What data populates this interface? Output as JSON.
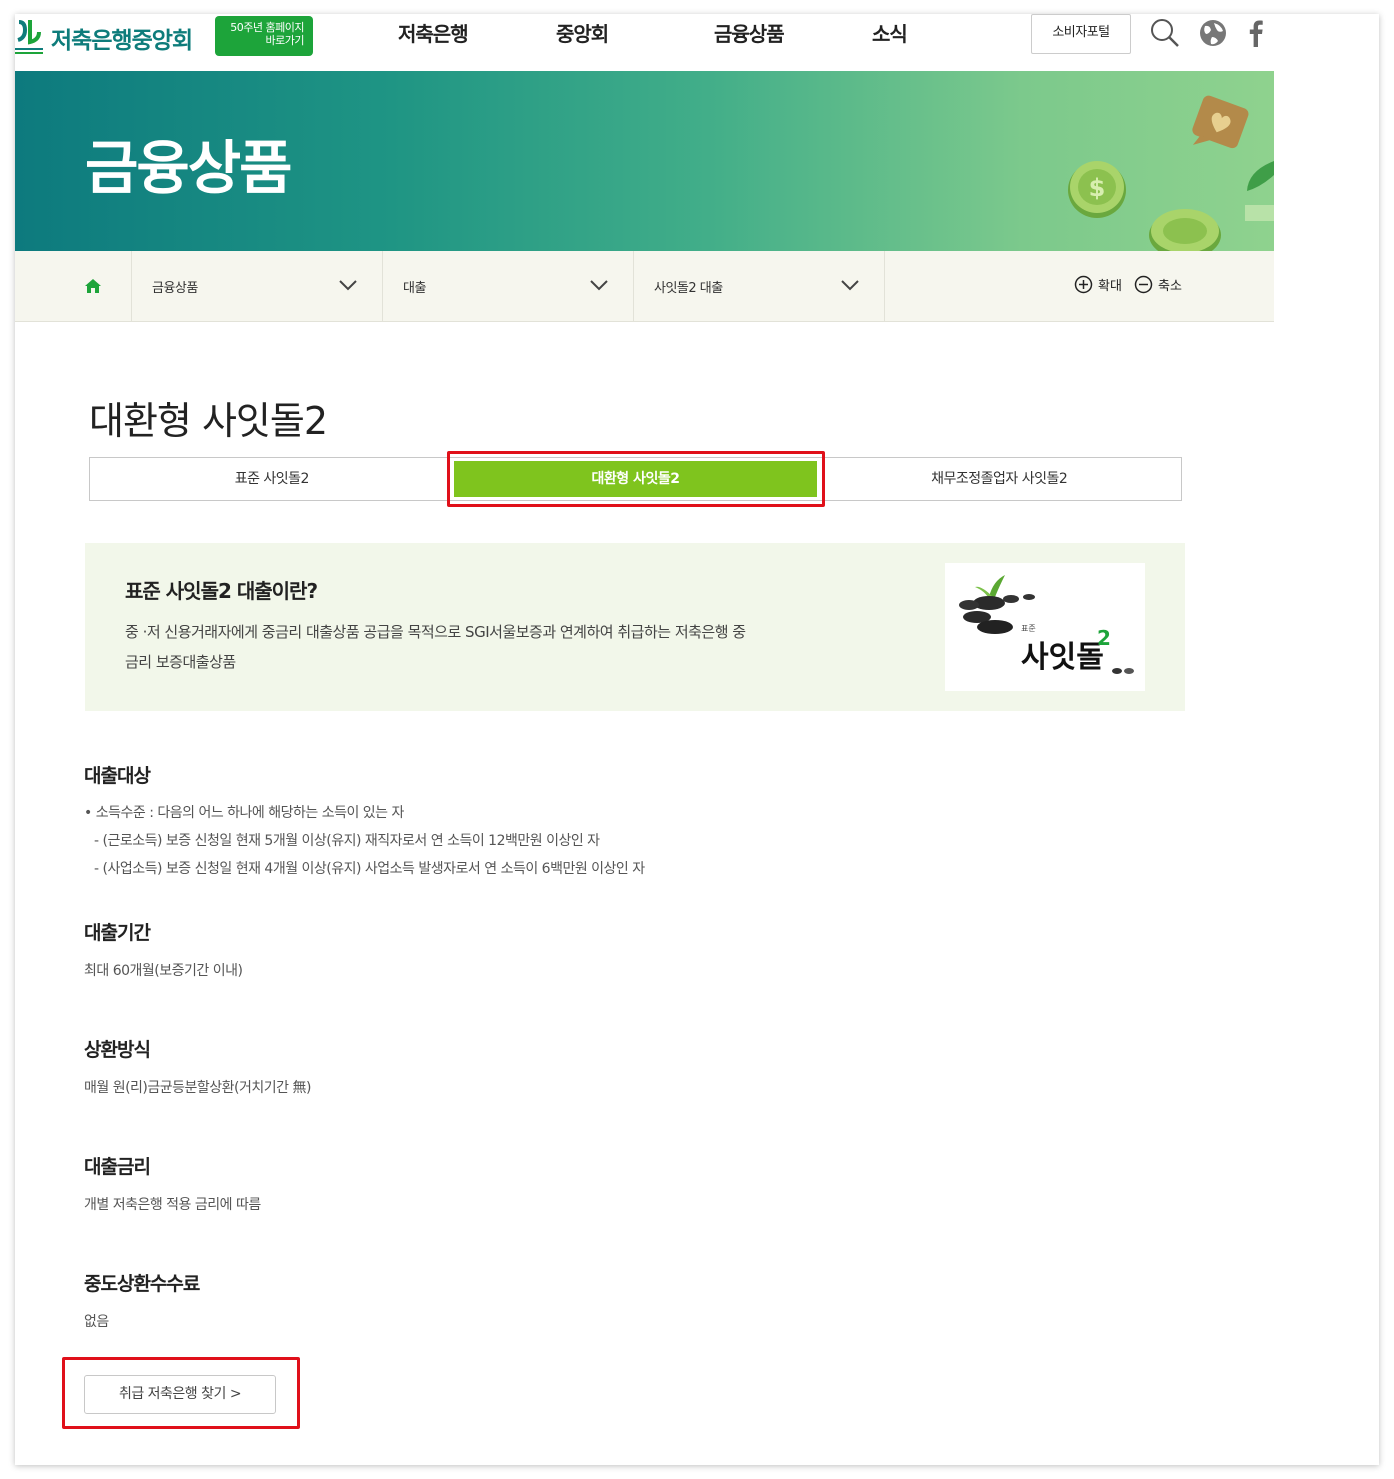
{
  "header": {
    "logo_text": "저축은행중앙회",
    "anniversary_line1": "50주년 홈페이지",
    "anniversary_line2": "바로가기",
    "nav": [
      "저축은행",
      "중앙회",
      "금융상품",
      "소식"
    ],
    "consumer_portal": "소비자포털"
  },
  "banner": {
    "title": "금융상품"
  },
  "location": {
    "selects": [
      "금융상품",
      "대출",
      "사잇돌2 대출"
    ],
    "zoom_in": "확대",
    "zoom_out": "축소"
  },
  "page": {
    "title": "대환형 사잇돌2",
    "tabs": [
      "표준 사잇돌2",
      "대환형 사잇돌2",
      "채무조정졸업자 사잇돌2"
    ],
    "active_tab_index": 1
  },
  "intro": {
    "title": "표준 사잇돌2 대출이란?",
    "desc_line1": "중 ·저 신용거래자에게 중금리 대출상품 공급을 목적으로 SGI서울보증과 연계하여 취급하는 저축은행 중",
    "desc_line2": "금리 보증대출상품",
    "img_small_label": "표준",
    "img_brand": "사잇돌",
    "img_sup": "2"
  },
  "sections": {
    "target": {
      "title": "대출대상",
      "bullet": "소득수준 : 다음의 어느 하나에 해당하는 소득이 있는 자",
      "sub1": "- (근로소득) 보증 신청일 현재 5개월 이상(유지) 재직자로서 연 소득이 12백만원 이상인 자",
      "sub2": "- (사업소득) 보증 신청일 현재 4개월 이상(유지) 사업소득 발생자로서 연 소득이 6백만원 이상인 자"
    },
    "period": {
      "title": "대출기간",
      "text": "최대 60개월(보증기간 이내)"
    },
    "repay": {
      "title": "상환방식",
      "text": "매월 원(리)금균등분할상환(거치기간 無)"
    },
    "rate": {
      "title": "대출금리",
      "text": "개별 저축은행 적용 금리에 따름"
    },
    "fee": {
      "title": "중도상환수수료",
      "text": "없음"
    }
  },
  "find_button": "취급 저축은행 찾기 >",
  "colors": {
    "brand_teal": "#0e7c7b",
    "accent_green": "#7fc41e",
    "highlight_red": "#e0101a"
  }
}
